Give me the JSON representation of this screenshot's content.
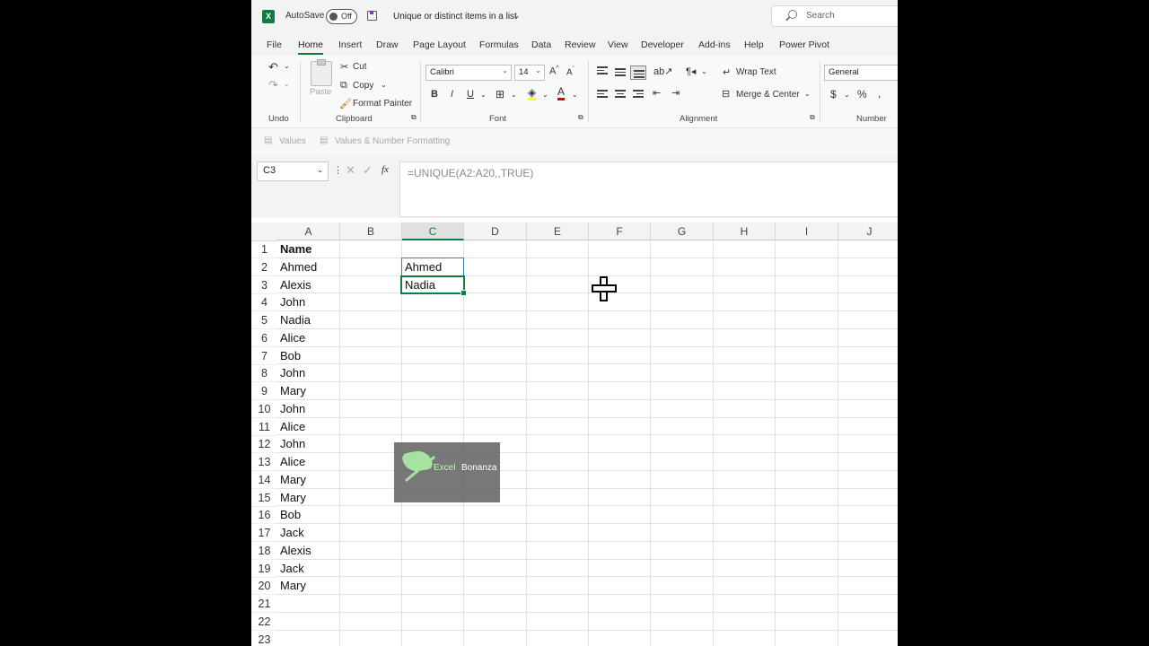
{
  "titlebar": {
    "app_icon": "excel-logo-icon",
    "autosave_label": "AutoSave",
    "toggle_state": "Off",
    "document_title": "Unique or distinct items in a list",
    "search_placeholder": "Search"
  },
  "menu": {
    "tabs": [
      "File",
      "Home",
      "Insert",
      "Draw",
      "Page Layout",
      "Formulas",
      "Data",
      "Review",
      "View",
      "Developer",
      "Add-ins",
      "Help",
      "Power Pivot"
    ],
    "active_tab": "Home"
  },
  "ribbon": {
    "undo_group": "Undo",
    "clipboard": {
      "paste": "Paste",
      "cut": "Cut",
      "copy": "Copy",
      "format_painter": "Format Painter",
      "label": "Clipboard"
    },
    "font": {
      "name": "Calibri",
      "size": "14",
      "label": "Font"
    },
    "alignment": {
      "wrap_text": "Wrap Text",
      "merge_center": "Merge & Center",
      "label": "Alignment"
    },
    "number": {
      "format": "General",
      "label": "Number"
    }
  },
  "pastebar": {
    "values": "Values",
    "values_number_formatting": "Values & Number Formatting"
  },
  "formula_bar": {
    "name_box": "C3",
    "fx": "fx",
    "formula": "=UNIQUE(A2:A20,,TRUE)"
  },
  "grid": {
    "columns": [
      "A",
      "B",
      "C",
      "D",
      "E",
      "F",
      "G",
      "H",
      "I",
      "J"
    ],
    "selected_column": "C",
    "rows": [
      "1",
      "2",
      "3",
      "4",
      "5",
      "6",
      "7",
      "8",
      "9",
      "10",
      "11",
      "12",
      "13",
      "14",
      "15",
      "16",
      "17",
      "18",
      "19",
      "20",
      "21",
      "22",
      "23"
    ],
    "column_a": [
      "Name",
      "Ahmed",
      "Alexis",
      "John",
      "Nadia",
      "Alice",
      "Bob",
      "John",
      "Mary",
      "John",
      "Alice",
      "John",
      "Alice",
      "Mary",
      "Mary",
      "Bob",
      "Jack",
      "Alexis",
      "Jack",
      "Mary"
    ],
    "column_c": [
      "Ahmed",
      "Nadia"
    ]
  },
  "watermark": {
    "part1": "Excel",
    "part2": "Bonanza"
  },
  "colors": {
    "excel_green": "#107c41",
    "spill_border": "#4472c4"
  }
}
